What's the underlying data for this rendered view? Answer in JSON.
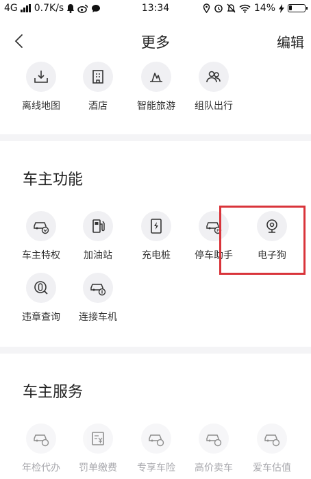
{
  "status_bar": {
    "network": "4G",
    "speed": "0.7K/s",
    "time": "13:34",
    "battery": "14%"
  },
  "header": {
    "title": "更多",
    "edit_label": "编辑"
  },
  "top_row": [
    {
      "label": "离线地图",
      "icon": "offline-map-icon"
    },
    {
      "label": "酒店",
      "icon": "hotel-icon"
    },
    {
      "label": "智能旅游",
      "icon": "smart-travel-icon"
    },
    {
      "label": "组队出行",
      "icon": "group-travel-icon"
    }
  ],
  "owner_functions": {
    "title": "车主功能",
    "items": [
      {
        "label": "车主特权",
        "icon": "car-privilege-icon"
      },
      {
        "label": "加油站",
        "icon": "gas-station-icon"
      },
      {
        "label": "充电桩",
        "icon": "charging-pile-icon"
      },
      {
        "label": "停车助手",
        "icon": "parking-assistant-icon"
      },
      {
        "label": "电子狗",
        "icon": "camera-dog-icon"
      },
      {
        "label": "违章查询",
        "icon": "violation-query-icon"
      },
      {
        "label": "连接车机",
        "icon": "connect-car-icon"
      }
    ]
  },
  "owner_services": {
    "title": "车主服务",
    "items": [
      {
        "label": "年检代办",
        "icon": "annual-inspection-icon"
      },
      {
        "label": "罚单缴费",
        "icon": "fine-payment-icon"
      },
      {
        "label": "专享车险",
        "icon": "car-insurance-icon"
      },
      {
        "label": "高价卖车",
        "icon": "sell-car-icon"
      },
      {
        "label": "爱车估值",
        "icon": "car-valuation-icon"
      }
    ]
  },
  "colors": {
    "highlight": "#d9343a",
    "icon_bg": "#f0f0f3",
    "divider": "#f4f4f6"
  }
}
